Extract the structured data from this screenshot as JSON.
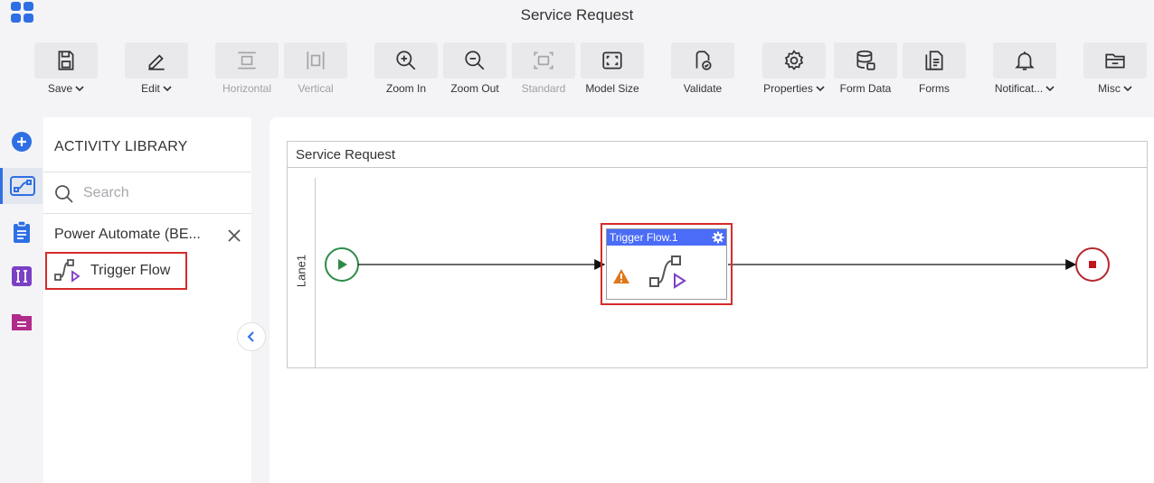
{
  "header": {
    "title": "Service Request"
  },
  "toolbar": {
    "save": "Save",
    "edit": "Edit",
    "horizontal": "Horizontal",
    "vertical": "Vertical",
    "zoom_in": "Zoom In",
    "zoom_out": "Zoom Out",
    "standard": "Standard",
    "model_size": "Model Size",
    "validate": "Validate",
    "properties": "Properties",
    "form_data": "Form Data",
    "forms": "Forms",
    "notifications": "Notificat...",
    "misc": "Misc"
  },
  "library": {
    "title": "ACTIVITY LIBRARY",
    "search_placeholder": "Search",
    "group": "Power Automate (BE...",
    "item": "Trigger Flow"
  },
  "canvas": {
    "pool_title": "Service Request",
    "lane": "Lane1",
    "task_title": "Trigger Flow.1"
  },
  "colors": {
    "accent": "#2f6fe4",
    "task_header": "#4a6cf7",
    "highlight": "#d52b2b",
    "start": "#2e8b47",
    "end": "#b5282e",
    "warning": "#e0761d"
  }
}
